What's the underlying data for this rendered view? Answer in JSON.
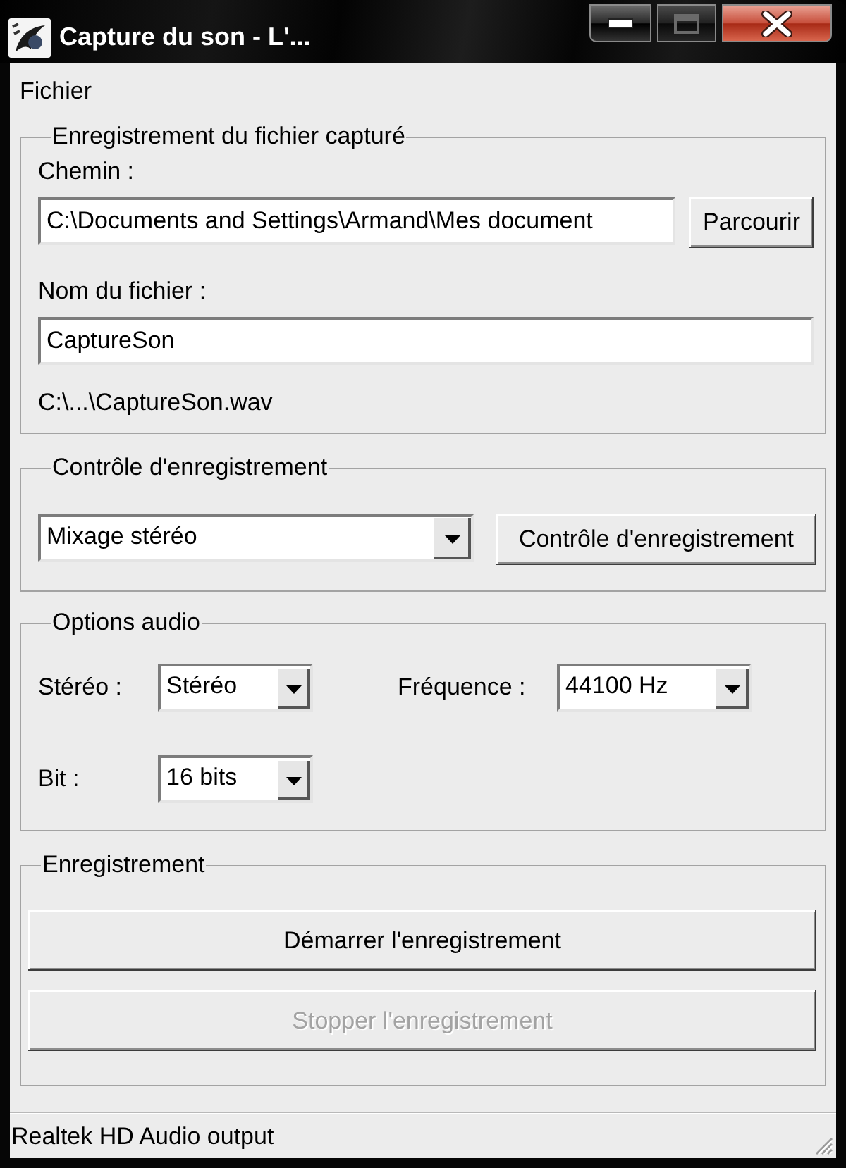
{
  "window": {
    "title": "Capture du son - L'...",
    "buttons": [
      {
        "kind": "minimize",
        "disabled": false
      },
      {
        "kind": "maximize",
        "disabled": true
      },
      {
        "kind": "close",
        "disabled": false
      }
    ]
  },
  "menu": [
    {
      "label": "Fichier"
    }
  ],
  "file_group": {
    "title": "Enregistrement du fichier capturé",
    "path_label": "Chemin :",
    "path_value": "C:\\Documents and Settings\\Armand\\Mes document",
    "browse_button": "Parcourir",
    "name_label": "Nom du fichier :",
    "name_value": "CaptureSon",
    "output_path": "C:\\...\\CaptureSon.wav"
  },
  "control_group": {
    "title": "Contrôle d'enregistrement",
    "source_value": "Mixage stéréo",
    "button": "Contrôle d'enregistrement"
  },
  "audio_group": {
    "title": "Options audio",
    "options": [
      {
        "label": "Stéréo :",
        "value": "Stéréo"
      },
      {
        "label": "Fréquence :",
        "value": "44100 Hz"
      },
      {
        "label": "Bit :",
        "value": "16 bits"
      }
    ]
  },
  "record_group": {
    "title": "Enregistrement",
    "buttons": [
      {
        "label": "Démarrer l'enregistrement",
        "disabled": false
      },
      {
        "label": "Stopper l'enregistrement",
        "disabled": true
      }
    ]
  },
  "status_bar": {
    "text": "Realtek HD Audio output"
  }
}
